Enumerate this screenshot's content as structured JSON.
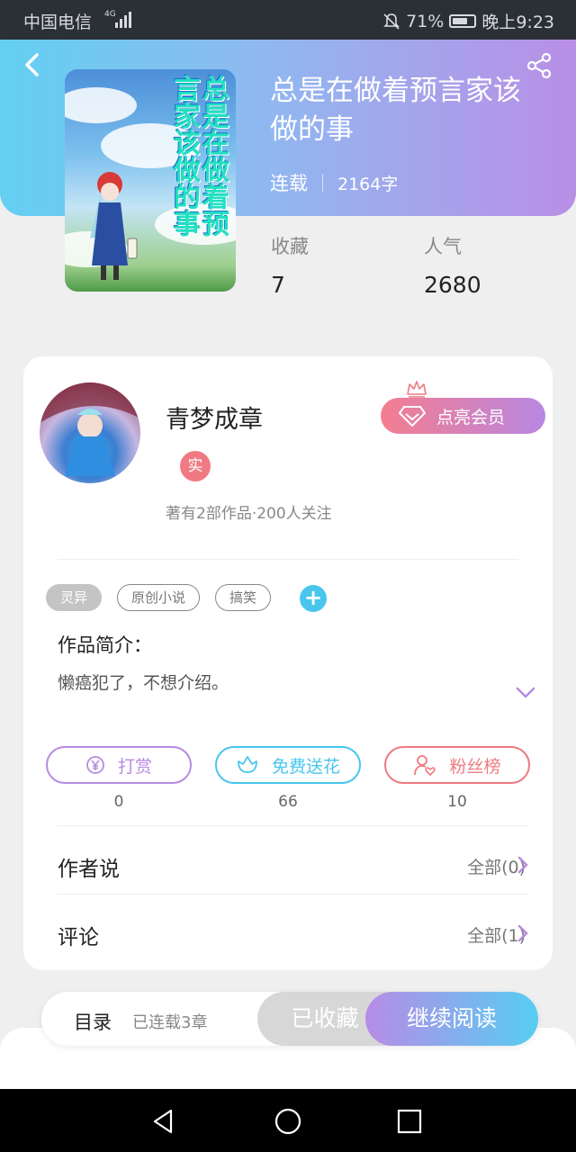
{
  "status_bar": {
    "carrier": "中国电信",
    "network": "4G",
    "battery": "71%",
    "time": "晚上9:23"
  },
  "book": {
    "title": "总是在做着预言家该做的事",
    "cover_text": "总是在做着预言家该做的事",
    "status": "连载",
    "word_count": "2164字",
    "stats": [
      {
        "label": "收藏",
        "value": "7"
      },
      {
        "label": "人气",
        "value": "2680"
      }
    ]
  },
  "author": {
    "name": "青梦成章",
    "badge": "实",
    "summary": "著有2部作品·200人关注",
    "vip_button": "点亮会员"
  },
  "tags": [
    "灵异",
    "原创小说",
    "搞笑"
  ],
  "intro": {
    "heading": "作品简介：",
    "text": "懒癌犯了，不想介绍。"
  },
  "actions": [
    {
      "label": "打赏",
      "count": "0",
      "color": "#b68be0"
    },
    {
      "label": "免费送花",
      "count": "66",
      "color": "#48c6ee"
    },
    {
      "label": "粉丝榜",
      "count": "10",
      "color": "#ee7a80"
    }
  ],
  "sections": [
    {
      "title": "作者说",
      "more": "全部(0)"
    },
    {
      "title": "评论",
      "more": "全部(1)"
    }
  ],
  "bottom_bar": {
    "toc_label": "目录",
    "toc_sub": "已连载3章",
    "fav_button": "已收藏",
    "read_button": "继续阅读"
  },
  "colors": {
    "accent_blue": "#57cdf1",
    "accent_purple": "#b78ce6",
    "accent_pink": "#f47d8f"
  }
}
